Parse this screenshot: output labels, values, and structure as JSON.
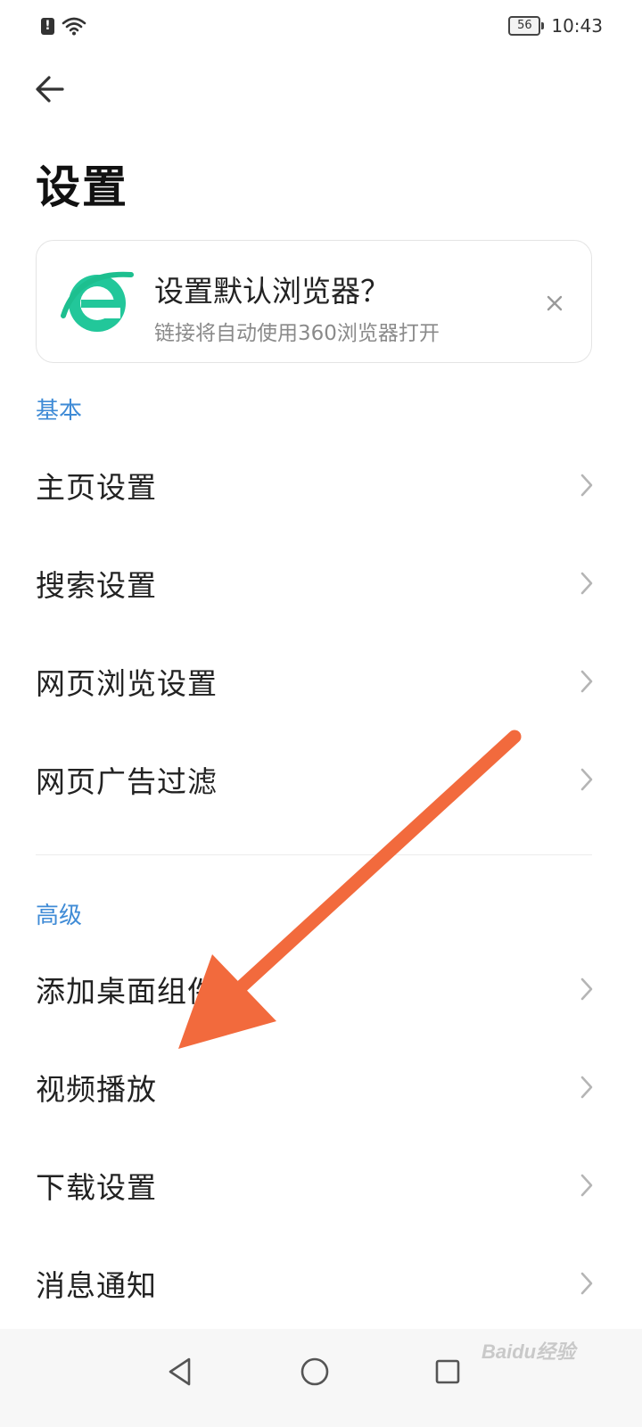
{
  "status_bar": {
    "battery": "56",
    "time": "10:43",
    "icons": [
      "alert-icon",
      "wifi-icon",
      "battery-icon"
    ]
  },
  "header": {
    "back_icon": "arrow-left-icon",
    "title": "设置"
  },
  "promo_card": {
    "logo_icon": "360-browser-logo",
    "title": "设置默认浏览器？",
    "subtitle": "链接将自动使用360浏览器打开",
    "close_icon": "close-icon"
  },
  "sections": [
    {
      "header": "基本",
      "items": [
        {
          "label": "主页设置"
        },
        {
          "label": "搜索设置"
        },
        {
          "label": "网页浏览设置"
        },
        {
          "label": "网页广告过滤"
        }
      ]
    },
    {
      "header": "高级",
      "items": [
        {
          "label": "添加桌面组件"
        },
        {
          "label": "视频播放"
        },
        {
          "label": "下载设置"
        },
        {
          "label": "消息通知"
        }
      ]
    }
  ],
  "nav_bar": {
    "icons": [
      "back-triangle-icon",
      "home-circle-icon",
      "recents-square-icon"
    ]
  },
  "watermark": "Baidu经验",
  "colors": {
    "accent_blue": "#3f8bd6",
    "annotation_arrow": "#f26a3d",
    "logo_green": "#1dbf8f"
  }
}
